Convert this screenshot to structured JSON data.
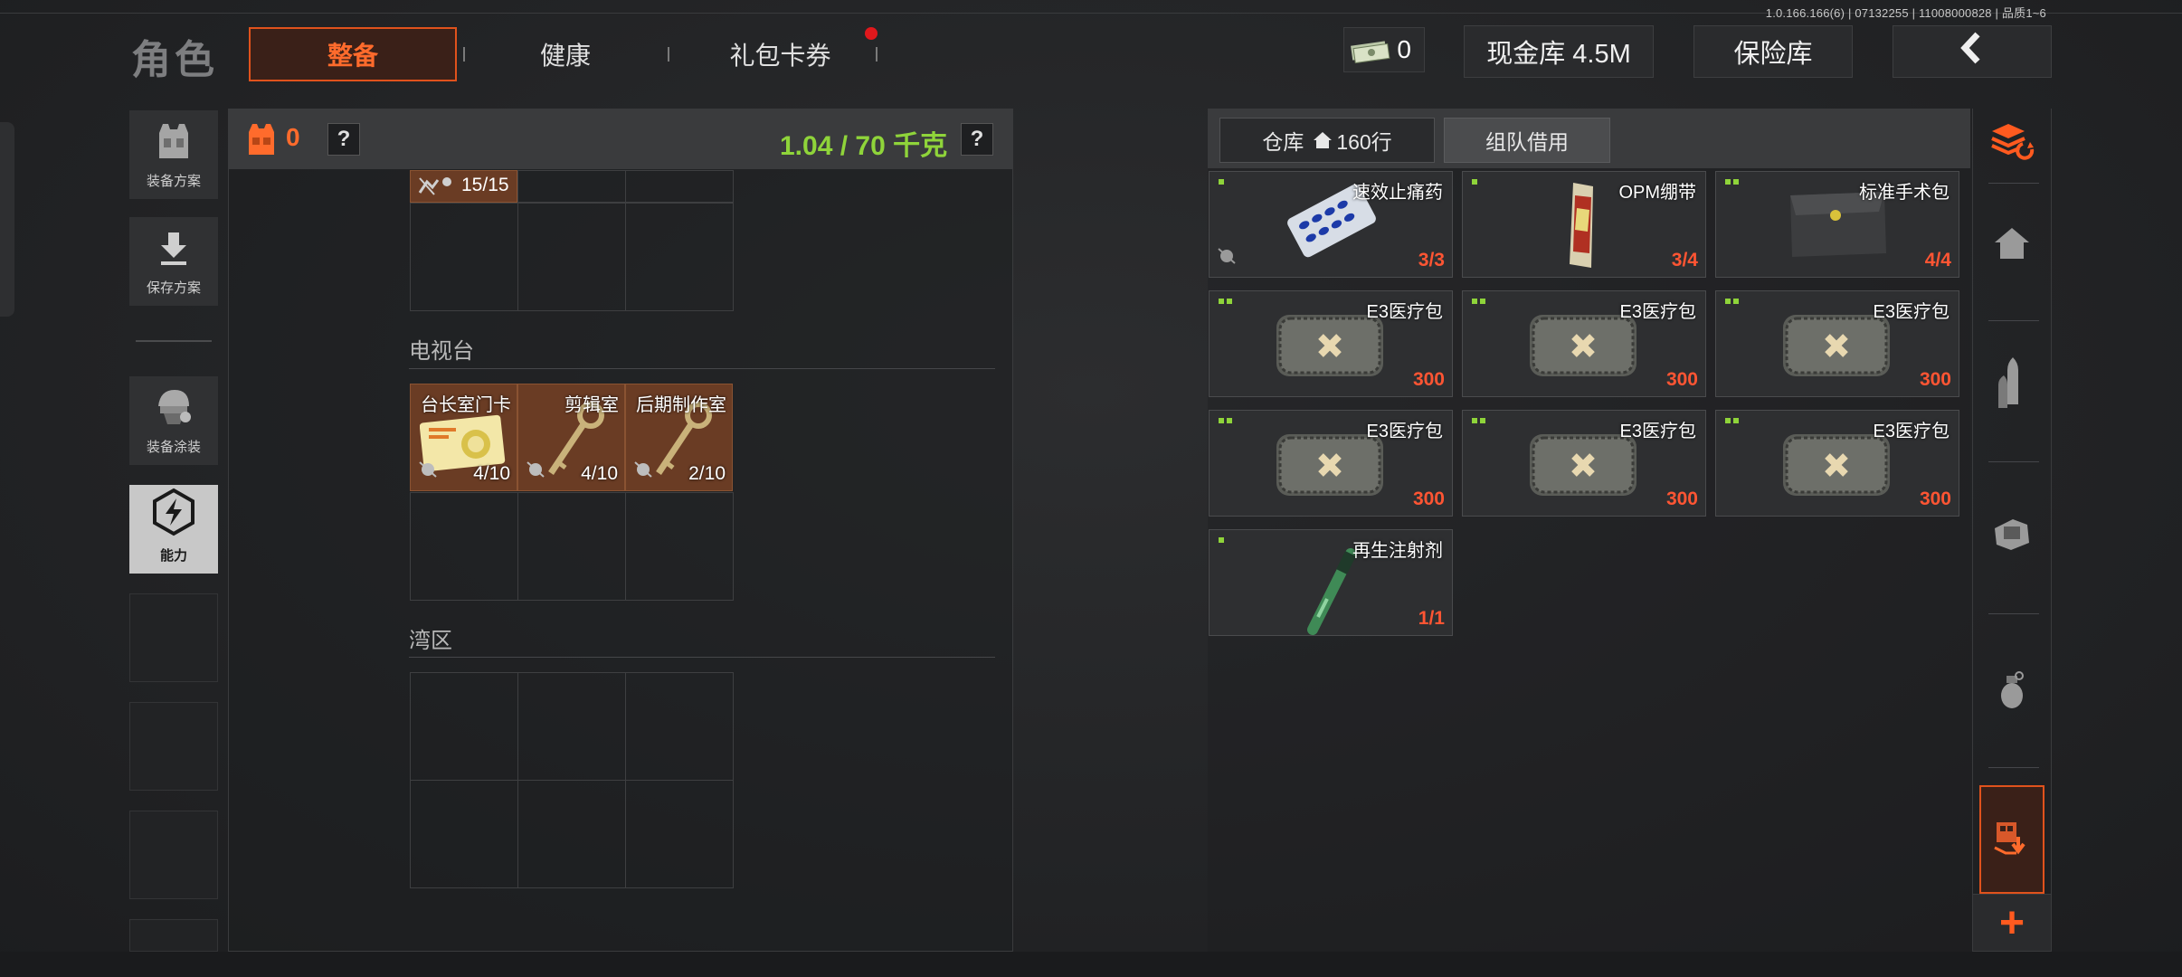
{
  "version": "1.0.166.166(6) | 07132255 | 11008000828 | 品质1~6",
  "header": {
    "title": "角色",
    "tabs": [
      {
        "label": "整备",
        "active": true
      },
      {
        "label": "健康",
        "active": false
      },
      {
        "label": "礼包卡券",
        "active": false,
        "notification": true
      }
    ],
    "cash_count": "0",
    "vault_label": "现金库 4.5M",
    "safe_label": "保险库",
    "back_icon": "chevron-left-icon"
  },
  "sidebar": {
    "items": [
      {
        "label": "装备方案",
        "icon": "vest-icon"
      },
      {
        "label": "保存方案",
        "icon": "download-icon"
      },
      {
        "label": "装备涂装",
        "icon": "helmet-icon"
      },
      {
        "label": "能力",
        "icon": "lightning-hex-icon",
        "active": true
      }
    ]
  },
  "loadout": {
    "vest_count": "0",
    "help": "?",
    "weight": "1.04 / 70 千克",
    "top_item_count": "15/15",
    "sections": [
      {
        "label": "电视台",
        "items": [
          {
            "name": "台长室门卡",
            "count": "4/10"
          },
          {
            "name": "剪辑室",
            "count": "4/10"
          },
          {
            "name": "后期制作室",
            "count": "2/10"
          }
        ]
      },
      {
        "label": "湾区",
        "items": []
      }
    ]
  },
  "stash": {
    "tab_warehouse": "仓库",
    "tab_warehouse_rows": "160行",
    "tab_team": "组队借用",
    "items": [
      {
        "name": "速效止痛药",
        "count": "3/3",
        "rarity": 1,
        "icon": "pill-pack-icon"
      },
      {
        "name": "OPM绷带",
        "count": "3/4",
        "rarity": 1,
        "icon": "bandage-icon"
      },
      {
        "name": "标准手术包",
        "count": "4/4",
        "rarity": 2,
        "icon": "surgery-kit-icon"
      },
      {
        "name": "E3医疗包",
        "count": "300",
        "rarity": 2,
        "icon": "medkit-icon"
      },
      {
        "name": "E3医疗包",
        "count": "300",
        "rarity": 2,
        "icon": "medkit-icon"
      },
      {
        "name": "E3医疗包",
        "count": "300",
        "rarity": 2,
        "icon": "medkit-icon"
      },
      {
        "name": "E3医疗包",
        "count": "300",
        "rarity": 2,
        "icon": "medkit-icon"
      },
      {
        "name": "E3医疗包",
        "count": "300",
        "rarity": 2,
        "icon": "medkit-icon"
      },
      {
        "name": "E3医疗包",
        "count": "300",
        "rarity": 2,
        "icon": "medkit-icon"
      },
      {
        "name": "再生注射剂",
        "count": "1/1",
        "rarity": 1,
        "icon": "injector-icon"
      }
    ]
  },
  "nav": {
    "icons": [
      "stack-swap-icon",
      "home-icon",
      "ammo-icon",
      "sight-icon",
      "grenade-icon",
      "stash-transfer-icon"
    ],
    "plus": "+"
  },
  "colors": {
    "accent": "#e0521c",
    "weight_green": "#8fd43a",
    "count_red": "#ff5533"
  }
}
